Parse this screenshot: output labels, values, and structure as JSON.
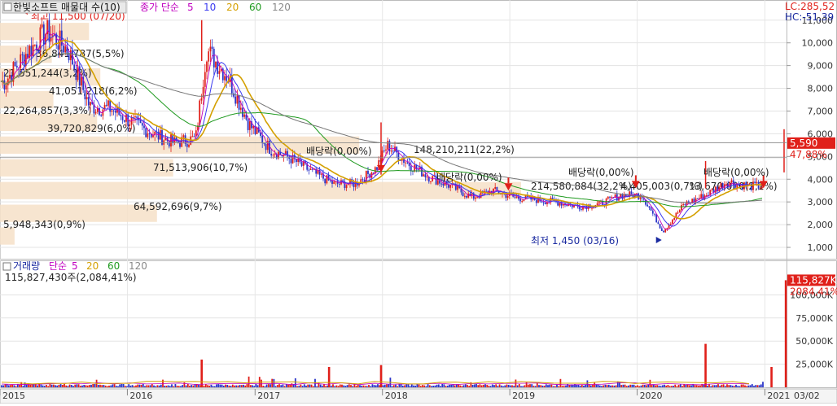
{
  "header": {
    "title": "한빛소프트 매물대 수(10)",
    "indicator_label": "종가 단순",
    "periods": [
      "5",
      "10",
      "20",
      "60",
      "120"
    ],
    "period_colors": [
      "#c000c0",
      "#3a3af0",
      "#d4a000",
      "#1f9a1f",
      "#888888"
    ]
  },
  "right_info": {
    "lc": "LC:285,52",
    "hc": "HC:-51,39"
  },
  "price_axis": {
    "ticks": [
      "11,000",
      "10,000",
      "9,000",
      "8,000",
      "7,000",
      "6,000",
      "5,000",
      "4,000",
      "3,000",
      "2,000",
      "1,000"
    ]
  },
  "current_price": {
    "label": "5,590",
    "pct": "47,88%"
  },
  "annotations": {
    "high": "최고 11,500 (07/20)",
    "low": "최저 1,450 (03/16)",
    "dividend": "배당락(0,00%)"
  },
  "volume_profile": [
    {
      "label": "36,841,787(5,5%)"
    },
    {
      "label": "21,551,244(3,2%)"
    },
    {
      "label": "41,051,218(6,2%)"
    },
    {
      "label": "22,264,857(3,3%)"
    },
    {
      "label": "39,720,829(6,0%)"
    },
    {
      "label": "148,210,211(22,2%)"
    },
    {
      "label": "71,513,906(10,7%)"
    },
    {
      "label": "214,580,884(32,2%)"
    },
    {
      "label": "64,592,696(9,7%)"
    },
    {
      "label": "4,405,003(0,7%)"
    },
    {
      "label": "13,670,000(2,1%)"
    },
    {
      "label": "5,948,343(0,9%)"
    }
  ],
  "volume_panel": {
    "title": "거래량",
    "indicator_label": "단순",
    "periods": [
      "5",
      "20",
      "60",
      "120"
    ],
    "period_colors": [
      "#c000c0",
      "#d4a000",
      "#1f9a1f",
      "#888888"
    ],
    "value_text": "115,827,430주(2,084,41%)",
    "current_label": "115,827K",
    "current_pct": "2084,41%",
    "ticks": [
      "100,000K",
      "75,000K",
      "50,000K",
      "25,000K"
    ]
  },
  "x_axis": {
    "years": [
      "2015",
      "2016",
      "2017",
      "2018",
      "2019",
      "2020",
      "2021",
      "03/02"
    ]
  },
  "chart_data": {
    "type": "candlestick",
    "title": "한빛소프트 매물대 수(10)",
    "x_range": [
      "2015-01",
      "2021-03"
    ],
    "price_range": [
      1000,
      11500
    ],
    "high": {
      "date": "2015-07-20",
      "value": 11500
    },
    "low": {
      "date": "2020-03-16",
      "value": 1450
    },
    "last_close": 5590,
    "close_path": [
      [
        "2015-01",
        8300
      ],
      [
        "2015-03",
        9500
      ],
      [
        "2015-05",
        10500
      ],
      [
        "2015-07",
        9700
      ],
      [
        "2015-09",
        7200
      ],
      [
        "2015-11",
        7100
      ],
      [
        "2016-01",
        6500
      ],
      [
        "2016-03",
        6000
      ],
      [
        "2016-05",
        5600
      ],
      [
        "2016-07",
        5800
      ],
      [
        "2016-08",
        9700
      ],
      [
        "2016-10",
        8500
      ],
      [
        "2016-12",
        6400
      ],
      [
        "2017-02",
        5300
      ],
      [
        "2017-04",
        4900
      ],
      [
        "2017-06",
        4300
      ],
      [
        "2017-08",
        3800
      ],
      [
        "2017-10",
        3800
      ],
      [
        "2017-12",
        4500
      ],
      [
        "2018-01",
        5500
      ],
      [
        "2018-03",
        4700
      ],
      [
        "2018-05",
        4100
      ],
      [
        "2018-07",
        3700
      ],
      [
        "2018-09",
        3200
      ],
      [
        "2018-11",
        3500
      ],
      [
        "2019-01",
        3200
      ],
      [
        "2019-03",
        3100
      ],
      [
        "2019-05",
        3000
      ],
      [
        "2019-07",
        2800
      ],
      [
        "2019-09",
        2900
      ],
      [
        "2019-11",
        3300
      ],
      [
        "2020-01",
        3300
      ],
      [
        "2020-03",
        1700
      ],
      [
        "2020-05",
        2900
      ],
      [
        "2020-07",
        3300
      ],
      [
        "2020-09",
        3900
      ],
      [
        "2020-11",
        3700
      ],
      [
        "2021-01",
        3700
      ],
      [
        "2021-02",
        4000
      ],
      [
        "2021-03",
        5590
      ]
    ],
    "volume_profile": [
      {
        "price": 10500,
        "volume": 36841787,
        "pct": 5.5
      },
      {
        "price": 9500,
        "volume": 21551244,
        "pct": 3.2
      },
      {
        "price": 8500,
        "volume": 41051218,
        "pct": 6.2
      },
      {
        "price": 7500,
        "volume": 22264857,
        "pct": 3.3
      },
      {
        "price": 6500,
        "volume": 39720829,
        "pct": 6.0
      },
      {
        "price": 5500,
        "volume": 148210211,
        "pct": 22.2
      },
      {
        "price": 4500,
        "volume": 71513906,
        "pct": 10.7
      },
      {
        "price": 3500,
        "volume": 214580884,
        "pct": 32.2
      },
      {
        "price": 2500,
        "volume": 64592696,
        "pct": 9.7
      },
      {
        "price": 1500,
        "volume": 5948343,
        "pct": 0.9
      }
    ],
    "dividend_marks": [
      {
        "date": "2017-12",
        "price": 4300
      },
      {
        "date": "2018-12",
        "price": 3500
      },
      {
        "date": "2019-12",
        "price": 3600
      },
      {
        "date": "2020-12",
        "price": 3600
      }
    ],
    "volume_range": [
      0,
      125000
    ],
    "volume_current": 115827
  }
}
